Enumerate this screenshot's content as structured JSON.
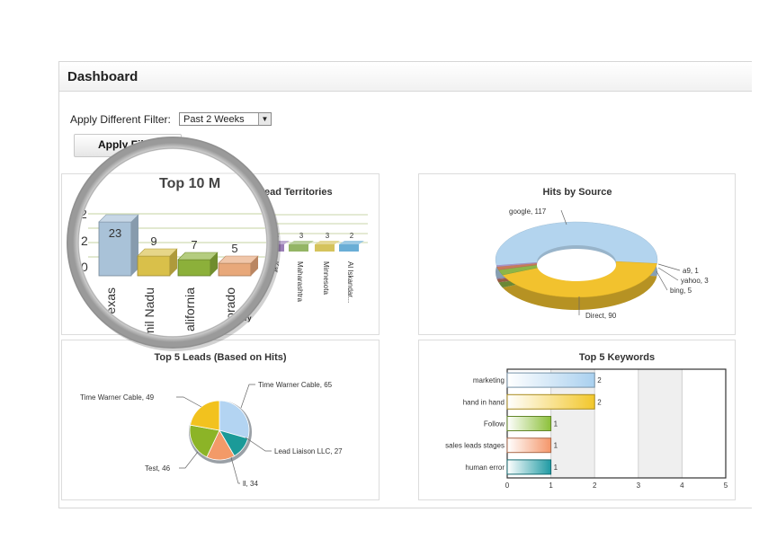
{
  "dashboard": {
    "title": "Dashboard",
    "filter_label": "Apply Different Filter:",
    "filter_value": "Past 2 Weeks",
    "apply_button": "Apply Filter"
  },
  "chart_data": [
    {
      "type": "bar",
      "title_parts": [
        "Top 10 M",
        "ead Territories"
      ],
      "xlabel": "ry",
      "categories": [
        "exas",
        "mil Nadu",
        "alifornia",
        "orado",
        "Kar",
        "Maharashtra",
        "Minnesota",
        "Al Iskandar..."
      ],
      "values": [
        23,
        9,
        7,
        5,
        3,
        3,
        3,
        2
      ],
      "ytick_labels": [
        "2",
        "0"
      ],
      "colors": [
        "#a9c2d8",
        "#d9c04a",
        "#8cb03a",
        "#e8a87a",
        "#9b7fb6",
        "#94b565",
        "#d5c35c",
        "#6aaed6"
      ]
    },
    {
      "type": "pie",
      "title": "Hits by Source",
      "labels": [
        "google",
        "Direct",
        "bing",
        "yahoo",
        "a9"
      ],
      "values": [
        117,
        90,
        5,
        3,
        1
      ],
      "slice_labels": [
        "google, 117",
        "Direct, 90",
        "bing, 5",
        "yahoo, 3",
        "a9, 1"
      ],
      "colors": [
        "#b3d4ee",
        "#f2c22e",
        "#8db548",
        "#c97a5a",
        "#b19bd0"
      ]
    },
    {
      "type": "pie",
      "title": "Top 5 Leads (Based on Hits)",
      "labels": [
        "Time Warner Cable",
        "Lead Liaison LLC",
        "ll",
        "Test",
        "Time Warner Cable"
      ],
      "values": [
        65,
        27,
        34,
        46,
        49
      ],
      "slice_labels": [
        "Time Warner Cable, 65",
        "Lead Liaison LLC, 27",
        "ll, 34",
        "Test, 46",
        "Time Warner Cable, 49"
      ],
      "colors": [
        "#b3d4f2",
        "#1b9a98",
        "#f39a68",
        "#8cb427",
        "#f2c21e"
      ]
    },
    {
      "type": "bar",
      "orientation": "horizontal",
      "title": "Top 5 Keywords",
      "categories": [
        "marketing",
        "hand in hand",
        "Follow",
        "sales leads stages",
        "human error"
      ],
      "values": [
        2,
        2,
        1,
        1,
        1
      ],
      "xlim": [
        0,
        5
      ],
      "xtick_labels": [
        "0",
        "1",
        "2",
        "3",
        "4",
        "5"
      ],
      "colors": [
        "#a9d0ef",
        "#f2c72b",
        "#8cc03a",
        "#f4966a",
        "#1f9aa3"
      ]
    }
  ]
}
